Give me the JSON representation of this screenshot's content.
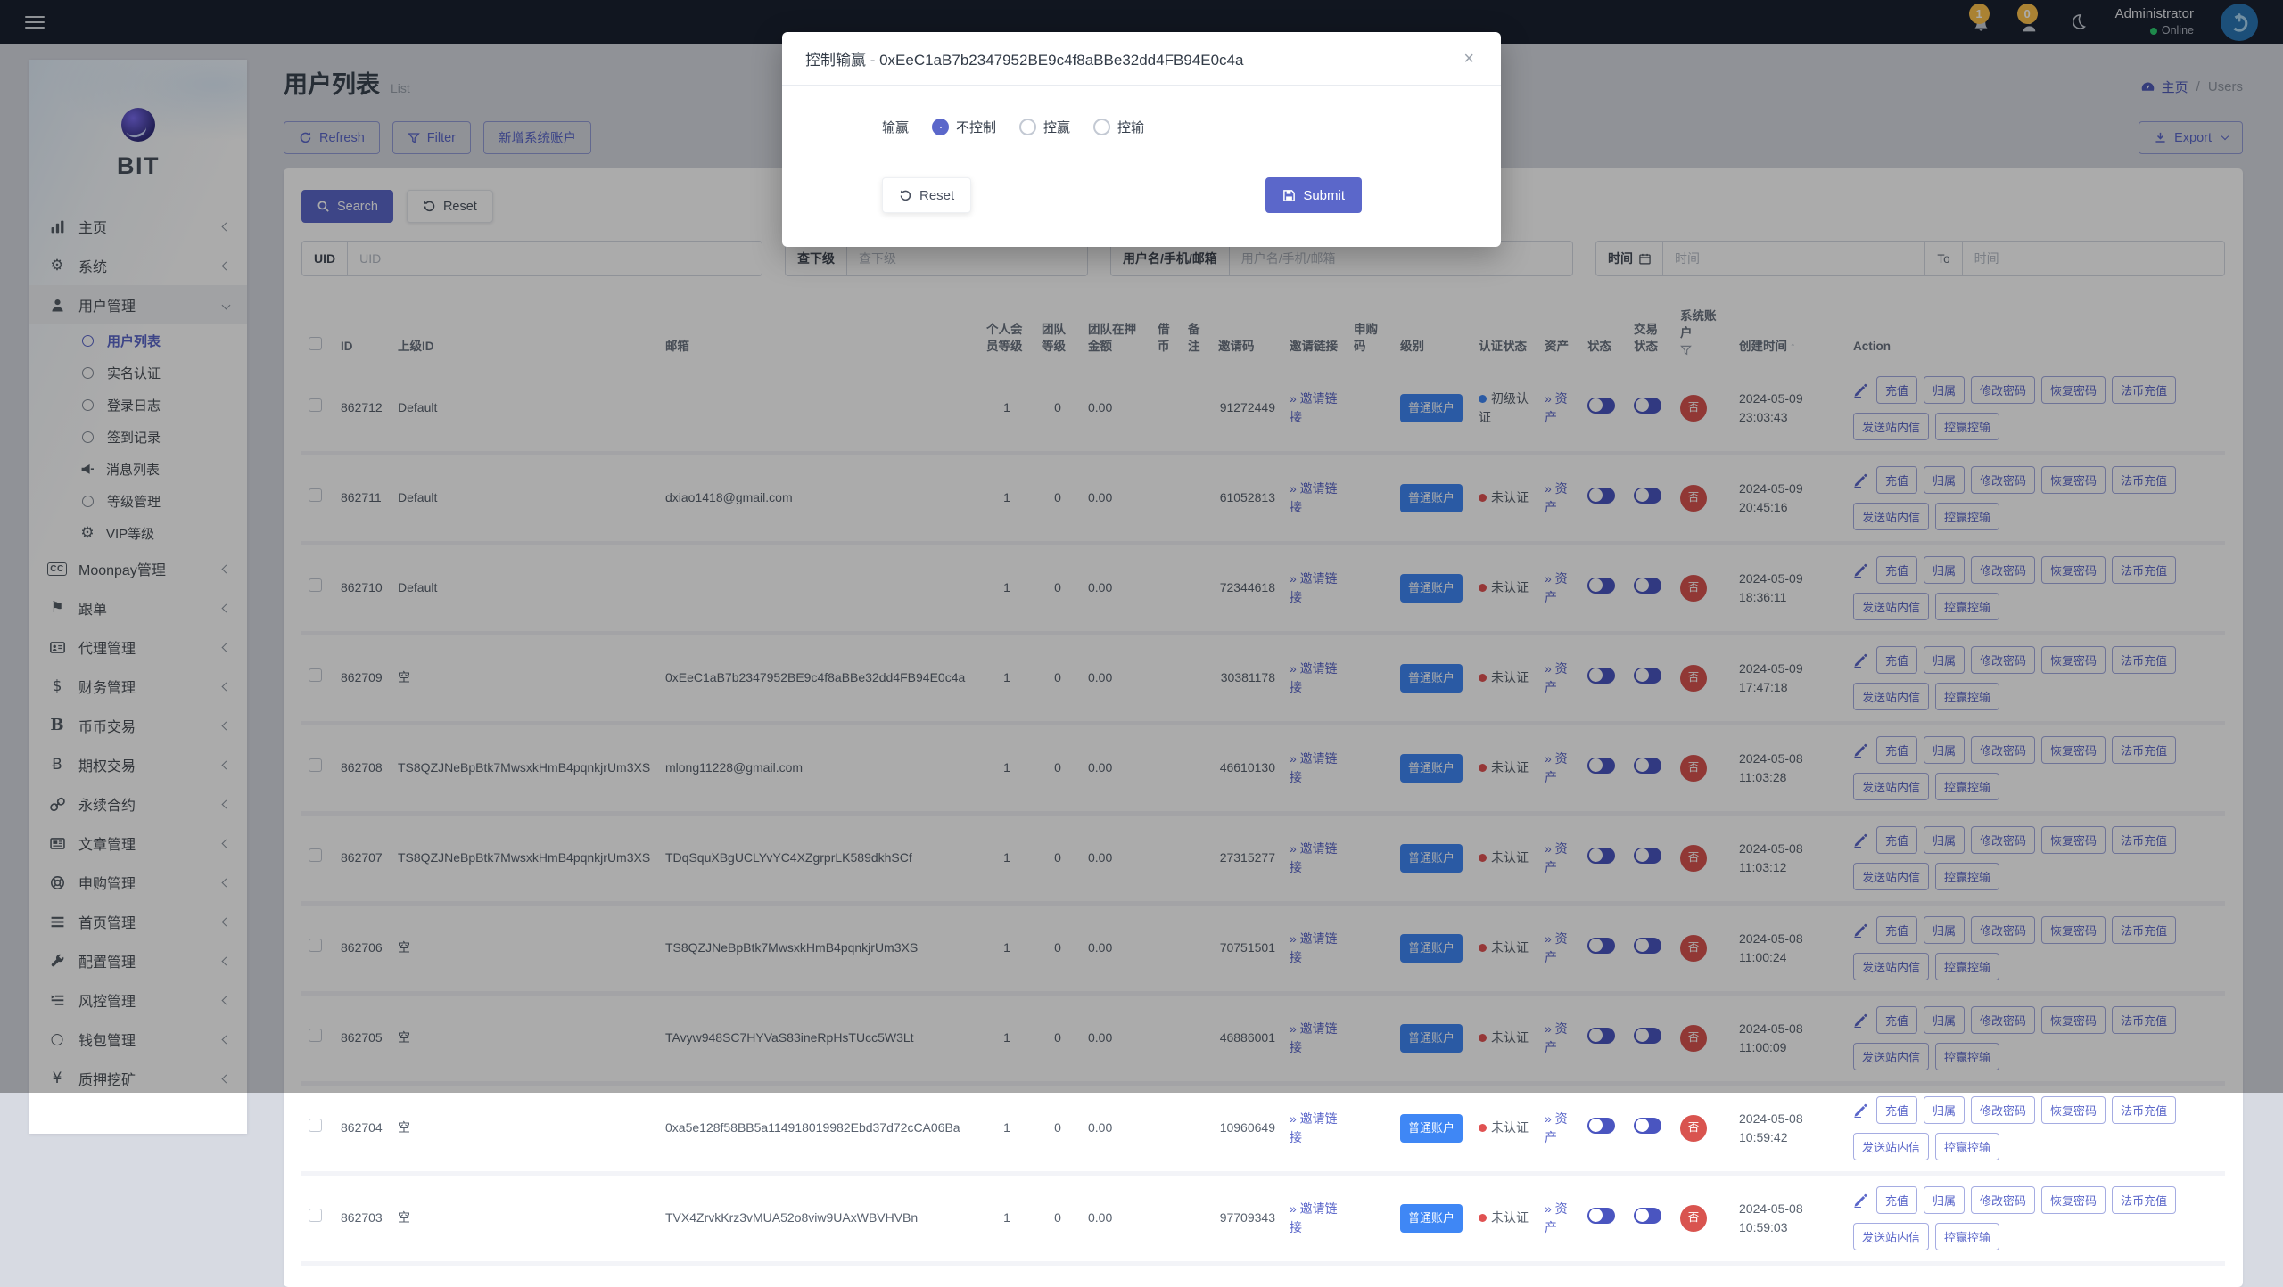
{
  "topbar": {
    "bell_count": "1",
    "user_count": "0",
    "username": "Administrator",
    "status": "Online"
  },
  "breadcrumb": {
    "home": "主页",
    "separator": "/",
    "current": "Users"
  },
  "header": {
    "title": "用户列表",
    "subtitle": "List"
  },
  "toolbar": {
    "refresh": "Refresh",
    "filter": "Filter",
    "add_account": "新增系统账户",
    "export": "Export"
  },
  "filters": {
    "search": "Search",
    "reset": "Reset",
    "uid": {
      "label": "UID",
      "placeholder": "UID"
    },
    "sub": {
      "label": "查下级",
      "placeholder": "查下级"
    },
    "user": {
      "label": "用户名/手机/邮箱",
      "placeholder": "用户名/手机/邮箱"
    },
    "time": {
      "label": "时间",
      "placeholder_start": "时间",
      "to": "To",
      "placeholder_end": "时间"
    }
  },
  "sidebar": {
    "brand": "BIT",
    "items": [
      {
        "type": "parent",
        "icon": "chart",
        "label": "主页"
      },
      {
        "type": "parent",
        "icon": "gear",
        "label": "系统"
      },
      {
        "type": "parent",
        "icon": "user",
        "label": "用户管理",
        "expanded": true,
        "active": true
      },
      {
        "type": "sub",
        "icon": "circle",
        "label": "用户列表",
        "active": true
      },
      {
        "type": "sub",
        "icon": "circle",
        "label": "实名认证"
      },
      {
        "type": "sub",
        "icon": "circle",
        "label": "登录日志"
      },
      {
        "type": "sub",
        "icon": "circle",
        "label": "签到记录"
      },
      {
        "type": "sub",
        "icon": "mega",
        "label": "消息列表"
      },
      {
        "type": "sub",
        "icon": "circle",
        "label": "等级管理"
      },
      {
        "type": "sub",
        "icon": "gearsolid",
        "label": "VIP等级"
      },
      {
        "type": "parent",
        "icon": "cc",
        "label": "Moonpay管理"
      },
      {
        "type": "parent",
        "icon": "flag",
        "label": "跟单"
      },
      {
        "type": "parent",
        "icon": "idcard",
        "label": "代理管理"
      },
      {
        "type": "parent",
        "icon": "dollar",
        "label": "财务管理"
      },
      {
        "type": "parent",
        "icon": "bserif",
        "label": "币币交易"
      },
      {
        "type": "parent",
        "icon": "bstroke",
        "label": "期权交易"
      },
      {
        "type": "parent",
        "icon": "chain",
        "label": "永续合约"
      },
      {
        "type": "parent",
        "icon": "news",
        "label": "文章管理"
      },
      {
        "type": "parent",
        "icon": "ring",
        "label": "申购管理"
      },
      {
        "type": "parent",
        "icon": "bars",
        "label": "首页管理"
      },
      {
        "type": "parent",
        "icon": "wrench",
        "label": "配置管理"
      },
      {
        "type": "parent",
        "icon": "indent",
        "label": "风控管理"
      },
      {
        "type": "parent",
        "icon": "circleo",
        "label": "钱包管理"
      },
      {
        "type": "parent",
        "icon": "yen",
        "label": "质押挖矿"
      }
    ]
  },
  "table": {
    "headers": [
      "ID",
      "上级ID",
      "邮箱",
      "个人会员等级",
      "团队等级",
      "团队在押金额",
      "借币",
      "备注",
      "邀请码",
      "邀请链接",
      "申购码",
      "级别",
      "认证状态",
      "资产",
      "状态",
      "交易状态",
      "系统账户",
      "创建时间",
      "Action"
    ],
    "invite_link_label": "» 邀请链接",
    "asset_link_label": "» 资产",
    "level_label": "普通账户",
    "system_account_label": "否",
    "action_buttons": [
      "充值",
      "归属",
      "修改密码",
      "恢复密码",
      "法币充值",
      "发送站内信",
      "控赢控输"
    ],
    "rows": [
      {
        "id": "862712",
        "parent_id": "Default",
        "email": "",
        "member_level": "1",
        "team_level": "0",
        "team_pledge": "0.00",
        "borrow": "",
        "note": "",
        "invite_code": "91272449",
        "subscribe_code": "",
        "auth": {
          "text": "初级认证",
          "color": "blue"
        },
        "status_on": true,
        "trade_on": true,
        "created": "2024-05-09 23:03:43"
      },
      {
        "id": "862711",
        "parent_id": "Default",
        "email": "dxiao1418@gmail.com",
        "member_level": "1",
        "team_level": "0",
        "team_pledge": "0.00",
        "borrow": "",
        "note": "",
        "invite_code": "61052813",
        "subscribe_code": "",
        "auth": {
          "text": "未认证",
          "color": "red"
        },
        "status_on": true,
        "trade_on": true,
        "created": "2024-05-09 20:45:16"
      },
      {
        "id": "862710",
        "parent_id": "Default",
        "email": "",
        "member_level": "1",
        "team_level": "0",
        "team_pledge": "0.00",
        "borrow": "",
        "note": "",
        "invite_code": "72344618",
        "subscribe_code": "",
        "auth": {
          "text": "未认证",
          "color": "red"
        },
        "status_on": true,
        "trade_on": true,
        "created": "2024-05-09 18:36:11"
      },
      {
        "id": "862709",
        "parent_id": "空",
        "email": "0xEeC1aB7b2347952BE9c4f8aBBe32dd4FB94E0c4a",
        "member_level": "1",
        "team_level": "0",
        "team_pledge": "0.00",
        "borrow": "",
        "note": "",
        "invite_code": "30381178",
        "subscribe_code": "",
        "auth": {
          "text": "未认证",
          "color": "red"
        },
        "status_on": true,
        "trade_on": true,
        "created": "2024-05-09 17:47:18"
      },
      {
        "id": "862708",
        "parent_id": "TS8QZJNeBpBtk7MwsxkHmB4pqnkjrUm3XS",
        "email": "mlong11228@gmail.com",
        "member_level": "1",
        "team_level": "0",
        "team_pledge": "0.00",
        "borrow": "",
        "note": "",
        "invite_code": "46610130",
        "subscribe_code": "",
        "auth": {
          "text": "未认证",
          "color": "red"
        },
        "status_on": true,
        "trade_on": true,
        "created": "2024-05-08 11:03:28"
      },
      {
        "id": "862707",
        "parent_id": "TS8QZJNeBpBtk7MwsxkHmB4pqnkjrUm3XS",
        "email": "TDqSquXBgUCLYvYC4XZgrprLK589dkhSCf",
        "member_level": "1",
        "team_level": "0",
        "team_pledge": "0.00",
        "borrow": "",
        "note": "",
        "invite_code": "27315277",
        "subscribe_code": "",
        "auth": {
          "text": "未认证",
          "color": "red"
        },
        "status_on": true,
        "trade_on": true,
        "created": "2024-05-08 11:03:12"
      },
      {
        "id": "862706",
        "parent_id": "空",
        "email": "TS8QZJNeBpBtk7MwsxkHmB4pqnkjrUm3XS",
        "member_level": "1",
        "team_level": "0",
        "team_pledge": "0.00",
        "borrow": "",
        "note": "",
        "invite_code": "70751501",
        "subscribe_code": "",
        "auth": {
          "text": "未认证",
          "color": "red"
        },
        "status_on": true,
        "trade_on": true,
        "created": "2024-05-08 11:00:24"
      },
      {
        "id": "862705",
        "parent_id": "空",
        "email": "TAvyw948SC7HYVaS83ineRpHsTUcc5W3Lt",
        "member_level": "1",
        "team_level": "0",
        "team_pledge": "0.00",
        "borrow": "",
        "note": "",
        "invite_code": "46886001",
        "subscribe_code": "",
        "auth": {
          "text": "未认证",
          "color": "red"
        },
        "status_on": true,
        "trade_on": true,
        "created": "2024-05-08 11:00:09"
      },
      {
        "id": "862704",
        "parent_id": "空",
        "email": "0xa5e128f58BB5a114918019982Ebd37d72cCA06Ba",
        "member_level": "1",
        "team_level": "0",
        "team_pledge": "0.00",
        "borrow": "",
        "note": "",
        "invite_code": "10960649",
        "subscribe_code": "",
        "auth": {
          "text": "未认证",
          "color": "red"
        },
        "status_on": true,
        "trade_on": true,
        "created": "2024-05-08 10:59:42"
      },
      {
        "id": "862703",
        "parent_id": "空",
        "email": "TVX4ZrvkKrz3vMUA52o8viw9UAxWBVHVBn",
        "member_level": "1",
        "team_level": "0",
        "team_pledge": "0.00",
        "borrow": "",
        "note": "",
        "invite_code": "97709343",
        "subscribe_code": "",
        "auth": {
          "text": "未认证",
          "color": "red"
        },
        "status_on": true,
        "trade_on": true,
        "created": "2024-05-08 10:59:03"
      }
    ]
  },
  "modal": {
    "title": "控制输赢 - 0xEeC1aB7b2347952BE9c4f8aBBe32dd4FB94E0c4a",
    "close": "×",
    "field_label": "输赢",
    "options": [
      {
        "label": "不控制",
        "selected": true
      },
      {
        "label": "控赢",
        "selected": false
      },
      {
        "label": "控输",
        "selected": false
      }
    ],
    "reset": "Reset",
    "submit": "Submit"
  },
  "colors": {
    "accent": "#5b67ca",
    "primary_badge": "#3f87f5",
    "danger_badge": "#d9544f",
    "warning_badge": "#fec24c",
    "success_dot": "#2ecc71",
    "auth_unverified_dot": "#e05252",
    "auth_primary_dot": "#3f87f5"
  }
}
